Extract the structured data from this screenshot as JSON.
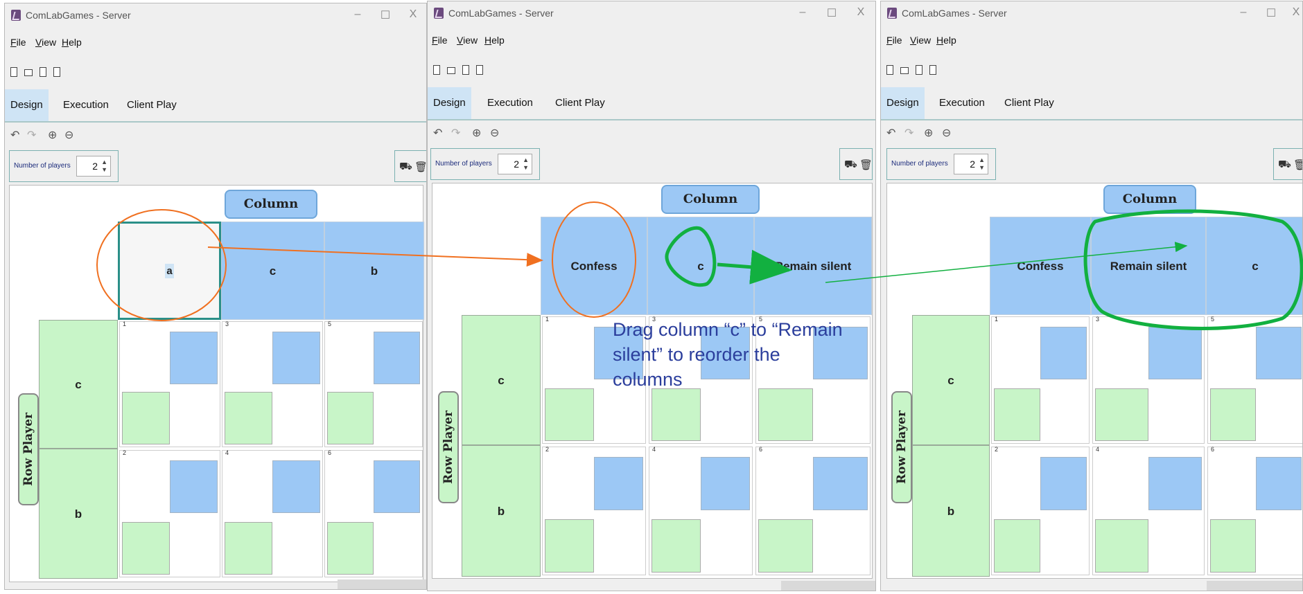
{
  "window_title": "ComLabGames - Server",
  "window_controls": {
    "minimize": "–",
    "maximize": "☐",
    "close": "X"
  },
  "menu": {
    "file": "File",
    "view": "View",
    "help": "Help"
  },
  "tabs": {
    "design": "Design",
    "execution": "Execution",
    "client_play": "Client Play"
  },
  "players": {
    "label": "Number of players",
    "value": "2",
    "up": "▲",
    "down": "▼"
  },
  "column_player": "Column Player",
  "row_player": "Row Player",
  "rows": [
    "c",
    "b"
  ],
  "cell_numbers": [
    "1",
    "3",
    "5",
    "2",
    "4",
    "6"
  ],
  "panels": [
    {
      "columns": [
        "a",
        "c",
        "b"
      ],
      "selected_column": 0
    },
    {
      "columns": [
        "Confess",
        "c",
        "Remain silent"
      ],
      "selected_column": -1
    },
    {
      "columns": [
        "Confess",
        "Remain silent",
        "c"
      ],
      "selected_column": -1
    }
  ],
  "annotation": {
    "line1": "Drag column “c” to “Remain",
    "line2": "silent” to reorder the",
    "line3": "columns"
  },
  "colors": {
    "column_blue": "#9cc8f5",
    "row_green": "#c8f5c8",
    "orange_annotation": "#f07020",
    "green_annotation": "#12b040",
    "annotation_text": "#2b3e9c",
    "selection_teal": "#2a8f88"
  }
}
